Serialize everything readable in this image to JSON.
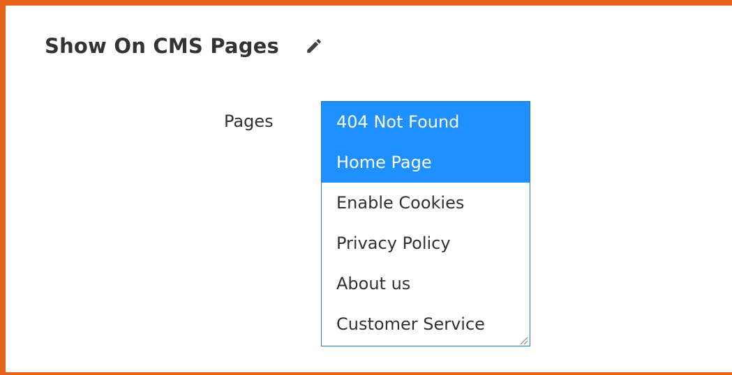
{
  "section": {
    "title": "Show On CMS Pages",
    "edit_icon": "pencil-icon"
  },
  "field": {
    "label": "Pages",
    "options": [
      {
        "label": "404 Not Found",
        "selected": true
      },
      {
        "label": "Home Page",
        "selected": true
      },
      {
        "label": "Enable Cookies",
        "selected": false
      },
      {
        "label": "Privacy Policy",
        "selected": false
      },
      {
        "label": "About us",
        "selected": false
      },
      {
        "label": "Customer Service",
        "selected": false
      }
    ]
  },
  "colors": {
    "accent_border": "#e8651e",
    "selected_background": "#1e90ff",
    "select_border": "#1979c3"
  }
}
